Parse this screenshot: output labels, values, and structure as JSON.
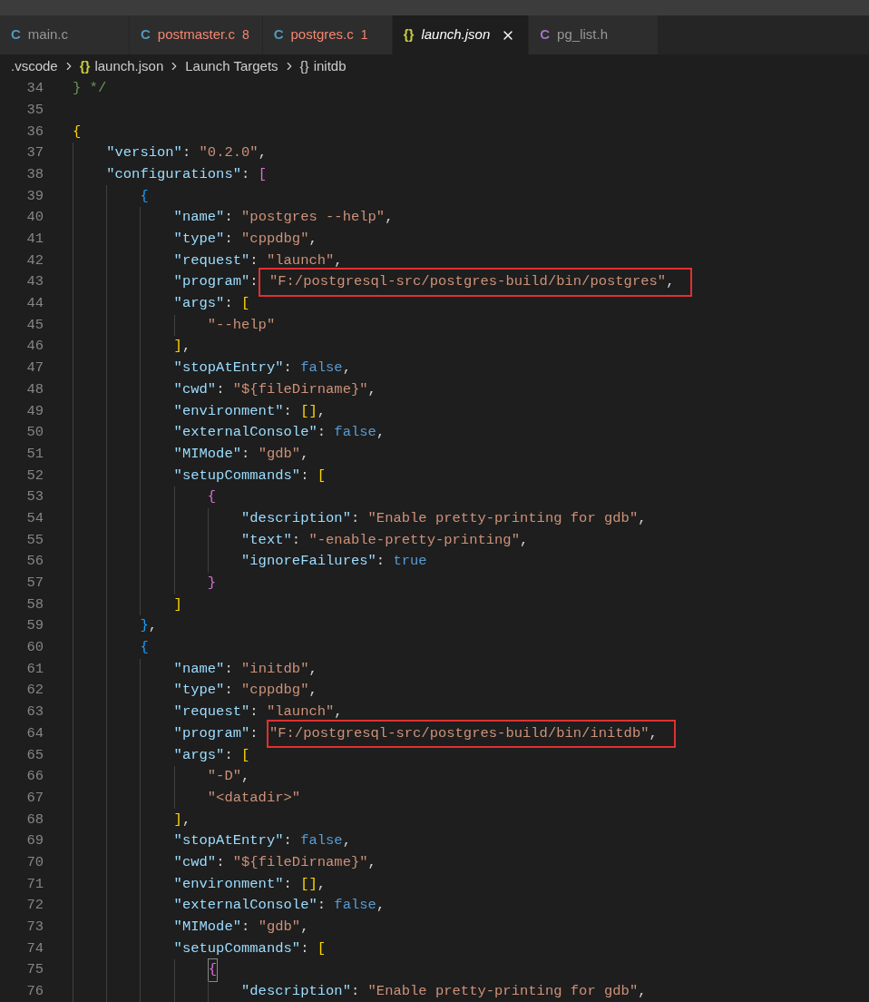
{
  "tabs": [
    {
      "icon": "C",
      "kind": "c",
      "label": "main.c",
      "error": false,
      "selected": false,
      "preview": false
    },
    {
      "icon": "C",
      "kind": "c",
      "label": "postmaster.c",
      "problems": "8",
      "error": true,
      "selected": false,
      "preview": false
    },
    {
      "icon": "C",
      "kind": "c",
      "label": "postgres.c",
      "problems": "1",
      "error": true,
      "selected": false,
      "preview": false
    },
    {
      "icon": "{}",
      "kind": "json",
      "label": "launch.json",
      "error": false,
      "selected": true,
      "preview": true
    },
    {
      "icon": "C",
      "kind": "h",
      "label": "pg_list.h",
      "error": false,
      "selected": false,
      "preview": false
    }
  ],
  "breadcrumbs": [
    {
      "label": ".vscode"
    },
    {
      "icon": "{}",
      "kind": "json",
      "label": "launch.json"
    },
    {
      "label": "Launch Targets"
    },
    {
      "icon": "{}",
      "kind": "object",
      "label": "initdb"
    }
  ],
  "lines": [
    {
      "number": "34",
      "tokens": [
        {
          "kind": "comment",
          "text": "} */"
        }
      ]
    },
    {
      "number": "35"
    },
    {
      "number": "36",
      "tokens": [
        {
          "kind": "bracket1",
          "text": "{"
        }
      ]
    },
    {
      "number": "37",
      "tokens": [
        {
          "kind": "key",
          "text": "    \"version\""
        },
        {
          "kind": "punct",
          "text": ": "
        },
        {
          "kind": "string",
          "text": "\"0.2.0\""
        },
        {
          "kind": "punct",
          "text": ","
        }
      ]
    },
    {
      "number": "38",
      "tokens": [
        {
          "kind": "key",
          "text": "    \"configurations\""
        },
        {
          "kind": "punct",
          "text": ": "
        },
        {
          "kind": "bracket2",
          "text": "["
        }
      ]
    },
    {
      "number": "39",
      "tokens": [
        {
          "kind": "bracket3",
          "text": "        {"
        }
      ]
    },
    {
      "number": "40",
      "tokens": [
        {
          "kind": "key",
          "text": "            \"name\""
        },
        {
          "kind": "punct",
          "text": ": "
        },
        {
          "kind": "string",
          "text": "\"postgres --help\""
        },
        {
          "kind": "punct",
          "text": ","
        }
      ]
    },
    {
      "number": "41",
      "tokens": [
        {
          "kind": "key",
          "text": "            \"type\""
        },
        {
          "kind": "punct",
          "text": ": "
        },
        {
          "kind": "string",
          "text": "\"cppdbg\""
        },
        {
          "kind": "punct",
          "text": ","
        }
      ]
    },
    {
      "number": "42",
      "tokens": [
        {
          "kind": "key",
          "text": "            \"request\""
        },
        {
          "kind": "punct",
          "text": ": "
        },
        {
          "kind": "string",
          "text": "\"launch\""
        },
        {
          "kind": "punct",
          "text": ","
        }
      ]
    },
    {
      "number": "43",
      "tokens": [
        {
          "kind": "key",
          "text": "            \"program\""
        },
        {
          "kind": "punct",
          "text": ":"
        },
        {
          "kind": "string",
          "text": " \"F:/postgresql-src/postgres-build/bin/postgres\"",
          "boxed": true
        },
        {
          "kind": "punct",
          "text": ",",
          "boxed": true
        }
      ]
    },
    {
      "number": "44",
      "tokens": [
        {
          "kind": "key",
          "text": "            \"args\""
        },
        {
          "kind": "punct",
          "text": ": "
        },
        {
          "kind": "bracket1",
          "text": "["
        }
      ]
    },
    {
      "number": "45",
      "tokens": [
        {
          "kind": "string",
          "text": "                \"--help\""
        }
      ]
    },
    {
      "number": "46",
      "tokens": [
        {
          "kind": "bracket1",
          "text": "            ]"
        },
        {
          "kind": "punct",
          "text": ","
        }
      ]
    },
    {
      "number": "47",
      "tokens": [
        {
          "kind": "key",
          "text": "            \"stopAtEntry\""
        },
        {
          "kind": "punct",
          "text": ": "
        },
        {
          "kind": "keyword",
          "text": "false"
        },
        {
          "kind": "punct",
          "text": ","
        }
      ]
    },
    {
      "number": "48",
      "tokens": [
        {
          "kind": "key",
          "text": "            \"cwd\""
        },
        {
          "kind": "punct",
          "text": ": "
        },
        {
          "kind": "string",
          "text": "\"${fileDirname}\""
        },
        {
          "kind": "punct",
          "text": ","
        }
      ]
    },
    {
      "number": "49",
      "tokens": [
        {
          "kind": "key",
          "text": "            \"environment\""
        },
        {
          "kind": "punct",
          "text": ": "
        },
        {
          "kind": "bracket1",
          "text": "[]"
        },
        {
          "kind": "punct",
          "text": ","
        }
      ]
    },
    {
      "number": "50",
      "tokens": [
        {
          "kind": "key",
          "text": "            \"externalConsole\""
        },
        {
          "kind": "punct",
          "text": ": "
        },
        {
          "kind": "keyword",
          "text": "false"
        },
        {
          "kind": "punct",
          "text": ","
        }
      ]
    },
    {
      "number": "51",
      "tokens": [
        {
          "kind": "key",
          "text": "            \"MIMode\""
        },
        {
          "kind": "punct",
          "text": ": "
        },
        {
          "kind": "string",
          "text": "\"gdb\""
        },
        {
          "kind": "punct",
          "text": ","
        }
      ]
    },
    {
      "number": "52",
      "tokens": [
        {
          "kind": "key",
          "text": "            \"setupCommands\""
        },
        {
          "kind": "punct",
          "text": ": "
        },
        {
          "kind": "bracket1",
          "text": "["
        }
      ]
    },
    {
      "number": "53",
      "tokens": [
        {
          "kind": "bracket2",
          "text": "                {"
        }
      ]
    },
    {
      "number": "54",
      "tokens": [
        {
          "kind": "key",
          "text": "                    \"description\""
        },
        {
          "kind": "punct",
          "text": ": "
        },
        {
          "kind": "string",
          "text": "\"Enable pretty-printing for gdb\""
        },
        {
          "kind": "punct",
          "text": ","
        }
      ]
    },
    {
      "number": "55",
      "tokens": [
        {
          "kind": "key",
          "text": "                    \"text\""
        },
        {
          "kind": "punct",
          "text": ": "
        },
        {
          "kind": "string",
          "text": "\"-enable-pretty-printing\""
        },
        {
          "kind": "punct",
          "text": ","
        }
      ]
    },
    {
      "number": "56",
      "tokens": [
        {
          "kind": "key",
          "text": "                    \"ignoreFailures\""
        },
        {
          "kind": "punct",
          "text": ": "
        },
        {
          "kind": "keyword",
          "text": "true"
        }
      ]
    },
    {
      "number": "57",
      "tokens": [
        {
          "kind": "bracket2",
          "text": "                }"
        }
      ]
    },
    {
      "number": "58",
      "tokens": [
        {
          "kind": "bracket1",
          "text": "            ]"
        }
      ]
    },
    {
      "number": "59",
      "tokens": [
        {
          "kind": "bracket3",
          "text": "        }"
        },
        {
          "kind": "punct",
          "text": ","
        }
      ]
    },
    {
      "number": "60",
      "tokens": [
        {
          "kind": "bracket3",
          "text": "        {"
        }
      ]
    },
    {
      "number": "61",
      "tokens": [
        {
          "kind": "key",
          "text": "            \"name\""
        },
        {
          "kind": "punct",
          "text": ": "
        },
        {
          "kind": "string",
          "text": "\"initdb\""
        },
        {
          "kind": "punct",
          "text": ","
        }
      ]
    },
    {
      "number": "62",
      "tokens": [
        {
          "kind": "key",
          "text": "            \"type\""
        },
        {
          "kind": "punct",
          "text": ": "
        },
        {
          "kind": "string",
          "text": "\"cppdbg\""
        },
        {
          "kind": "punct",
          "text": ","
        }
      ]
    },
    {
      "number": "63",
      "tokens": [
        {
          "kind": "key",
          "text": "            \"request\""
        },
        {
          "kind": "punct",
          "text": ": "
        },
        {
          "kind": "string",
          "text": "\"launch\""
        },
        {
          "kind": "punct",
          "text": ","
        }
      ]
    },
    {
      "number": "64",
      "tokens": [
        {
          "kind": "key",
          "text": "            \"program\""
        },
        {
          "kind": "punct",
          "text": ": "
        },
        {
          "kind": "string",
          "text": "\"F:/postgresql-src/postgres-build/bin/initdb\"",
          "boxed": true
        },
        {
          "kind": "punct",
          "text": ",",
          "boxed": true
        }
      ]
    },
    {
      "number": "65",
      "tokens": [
        {
          "kind": "key",
          "text": "            \"args\""
        },
        {
          "kind": "punct",
          "text": ": "
        },
        {
          "kind": "bracket1",
          "text": "["
        }
      ]
    },
    {
      "number": "66",
      "tokens": [
        {
          "kind": "string",
          "text": "                \"-D\""
        },
        {
          "kind": "punct",
          "text": ","
        }
      ]
    },
    {
      "number": "67",
      "tokens": [
        {
          "kind": "string",
          "text": "                \"<datadir>\""
        }
      ]
    },
    {
      "number": "68",
      "tokens": [
        {
          "kind": "bracket1",
          "text": "            ]"
        },
        {
          "kind": "punct",
          "text": ","
        }
      ]
    },
    {
      "number": "69",
      "tokens": [
        {
          "kind": "key",
          "text": "            \"stopAtEntry\""
        },
        {
          "kind": "punct",
          "text": ": "
        },
        {
          "kind": "keyword",
          "text": "false"
        },
        {
          "kind": "punct",
          "text": ","
        }
      ]
    },
    {
      "number": "70",
      "tokens": [
        {
          "kind": "key",
          "text": "            \"cwd\""
        },
        {
          "kind": "punct",
          "text": ": "
        },
        {
          "kind": "string",
          "text": "\"${fileDirname}\""
        },
        {
          "kind": "punct",
          "text": ","
        }
      ]
    },
    {
      "number": "71",
      "tokens": [
        {
          "kind": "key",
          "text": "            \"environment\""
        },
        {
          "kind": "punct",
          "text": ": "
        },
        {
          "kind": "bracket1",
          "text": "[]"
        },
        {
          "kind": "punct",
          "text": ","
        }
      ]
    },
    {
      "number": "72",
      "tokens": [
        {
          "kind": "key",
          "text": "            \"externalConsole\""
        },
        {
          "kind": "punct",
          "text": ": "
        },
        {
          "kind": "keyword",
          "text": "false"
        },
        {
          "kind": "punct",
          "text": ","
        }
      ]
    },
    {
      "number": "73",
      "tokens": [
        {
          "kind": "key",
          "text": "            \"MIMode\""
        },
        {
          "kind": "punct",
          "text": ": "
        },
        {
          "kind": "string",
          "text": "\"gdb\""
        },
        {
          "kind": "punct",
          "text": ","
        }
      ]
    },
    {
      "number": "74",
      "tokens": [
        {
          "kind": "key",
          "text": "            \"setupCommands\""
        },
        {
          "kind": "punct",
          "text": ": "
        },
        {
          "kind": "bracket1",
          "text": "["
        }
      ]
    },
    {
      "number": "75",
      "tokens": [
        {
          "kind": "bracket2",
          "text": "                {",
          "matched": true
        }
      ]
    },
    {
      "number": "76",
      "tokens": [
        {
          "kind": "key",
          "text": "                    \"description\""
        },
        {
          "kind": "punct",
          "text": ": "
        },
        {
          "kind": "string",
          "text": "\"Enable pretty-printing for gdb\""
        },
        {
          "kind": "punct",
          "text": ","
        }
      ]
    }
  ]
}
